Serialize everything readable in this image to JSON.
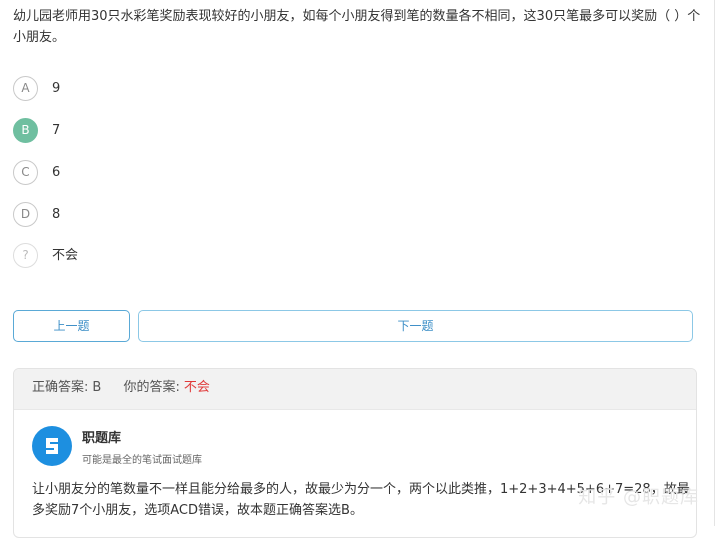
{
  "question": {
    "text": "幼儿园老师用30只水彩笔奖励表现较好的小朋友，如每个小朋友得到笔的数量各不相同，这30只笔最多可以奖励（ ）个小朋友。"
  },
  "options": [
    {
      "key": "A",
      "text": "9",
      "selected": false
    },
    {
      "key": "B",
      "text": "7",
      "selected": true
    },
    {
      "key": "C",
      "text": "6",
      "selected": false
    },
    {
      "key": "D",
      "text": "8",
      "selected": false
    },
    {
      "key": "?",
      "text": "不会",
      "selected": false
    }
  ],
  "navigation": {
    "prev_label": "上一题",
    "next_label": "下一题"
  },
  "answer": {
    "correct_label": "正确答案:",
    "correct_value": "B",
    "mine_label": "你的答案:",
    "mine_value": "不会"
  },
  "source": {
    "name": "职题库",
    "tagline": "可能是最全的笔试面试题库"
  },
  "explanation": "让小朋友分的笔数量不一样且能分给最多的人，故最少为分一个，两个以此类推，1+2+3+4+5+6+7=28，故最多奖励7个小朋友，选项ACD错误，故本题正确答案选B。",
  "watermark": "知乎 @职题库",
  "colors": {
    "selected_option": "#6fbfa0",
    "button_border": "#5aa9d6",
    "wrong_answer": "#e03a3a",
    "logo": "#1d8fe0"
  }
}
